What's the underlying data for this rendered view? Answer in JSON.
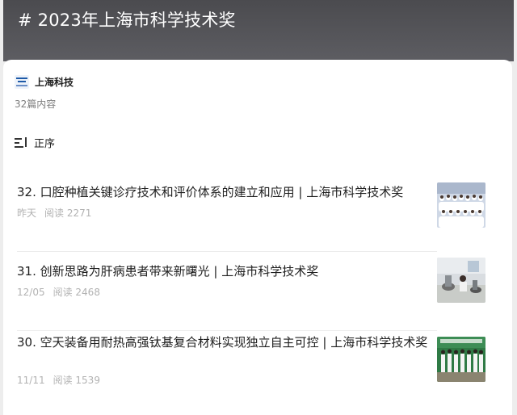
{
  "header": {
    "title": "# 2023年上海市科学技术奖"
  },
  "account": {
    "name": "上海科技",
    "logo_icon": "shanghai-sci-logo"
  },
  "summary": {
    "count_text": "32篇内容"
  },
  "sort": {
    "icon": "sort-icon",
    "label": "正序"
  },
  "articles": [
    {
      "title": "32. 口腔种植关键诊疗技术和评价体系的建立和应用 | 上海市科学技术奖",
      "date": "昨天",
      "reads": "阅读 2271"
    },
    {
      "title": "31. 创新思路为肝病患者带来新曙光 | 上海市科学技术奖",
      "date": "12/05",
      "reads": "阅读 2468"
    },
    {
      "title": "30. 空天装备用耐热高强钛基复合材料实现独立自主可控 | 上海市科学技术奖",
      "date": "11/11",
      "reads": "阅读 1539"
    }
  ],
  "colors": {
    "header_bg": "#55555a",
    "card_bg": "#ffffff",
    "meta_text": "#b2b2b2"
  }
}
